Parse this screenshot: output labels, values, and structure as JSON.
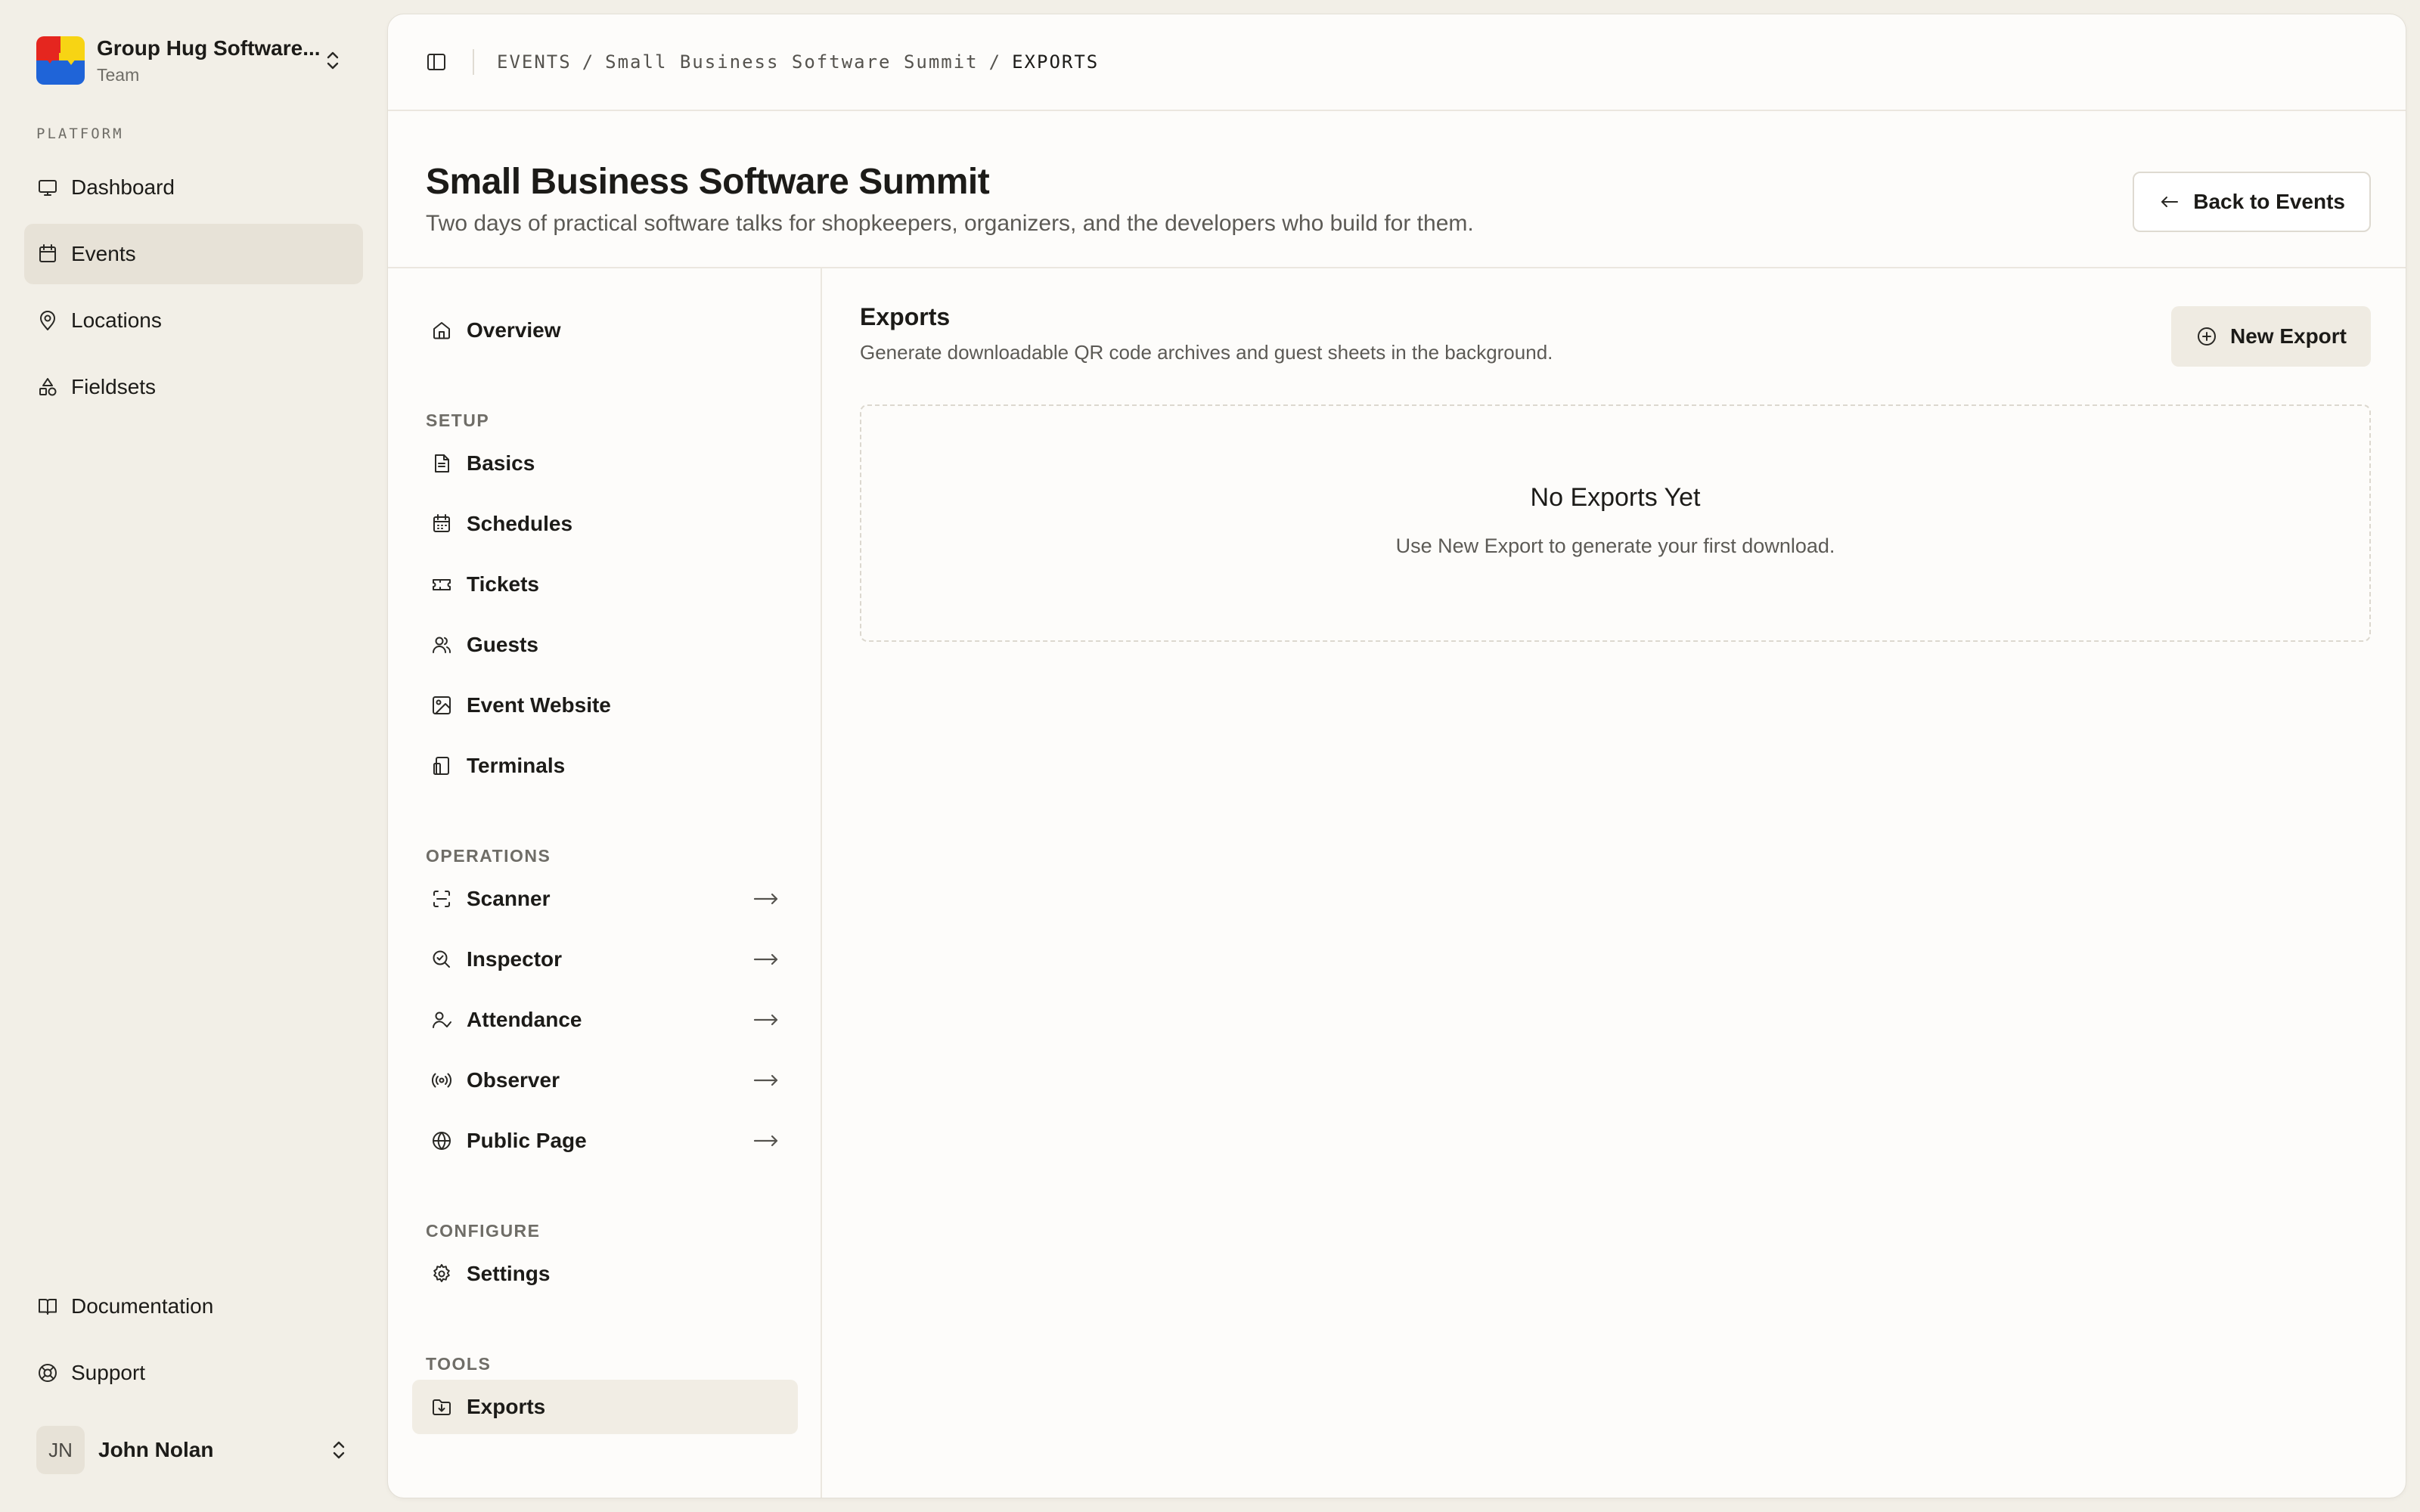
{
  "team": {
    "name": "Group Hug Software...",
    "subtitle": "Team"
  },
  "sidebar": {
    "group_label": "PLATFORM",
    "items": [
      {
        "label": "Dashboard",
        "icon": "monitor-icon",
        "active": false
      },
      {
        "label": "Events",
        "icon": "calendar-icon",
        "active": true
      },
      {
        "label": "Locations",
        "icon": "map-pin-icon",
        "active": false
      },
      {
        "label": "Fieldsets",
        "icon": "shapes-icon",
        "active": false
      }
    ],
    "bottom_items": [
      {
        "label": "Documentation",
        "icon": "book-icon"
      },
      {
        "label": "Support",
        "icon": "life-buoy-icon"
      }
    ],
    "user": {
      "initials": "JN",
      "name": "John Nolan"
    }
  },
  "breadcrumb": {
    "events": "EVENTS",
    "event": "Small Business Software Summit",
    "current": "EXPORTS",
    "separator": "/"
  },
  "header": {
    "title": "Small Business Software Summit",
    "description": "Two days of practical software talks for shopkeepers, organizers, and the developers who build for them.",
    "back_label": "Back to Events"
  },
  "event_nav": {
    "overview": "Overview",
    "sections": [
      {
        "label": "SETUP",
        "items": [
          "Basics",
          "Schedules",
          "Tickets",
          "Guests",
          "Event Website",
          "Terminals"
        ]
      },
      {
        "label": "OPERATIONS",
        "items": [
          "Scanner",
          "Inspector",
          "Attendance",
          "Observer",
          "Public Page"
        ]
      },
      {
        "label": "CONFIGURE",
        "items": [
          "Settings"
        ]
      },
      {
        "label": "TOOLS",
        "items": [
          "Exports"
        ]
      }
    ],
    "active": "Exports"
  },
  "exports": {
    "title": "Exports",
    "description": "Generate downloadable QR code archives and guest sheets in the background.",
    "new_label": "New Export",
    "empty_title": "No Exports Yet",
    "empty_description": "Use New Export to generate your first download."
  },
  "colors": {
    "background": "#f2efe7",
    "panel": "#fdfcfa",
    "active": "#e7e2d7",
    "button": "#efebe2"
  }
}
